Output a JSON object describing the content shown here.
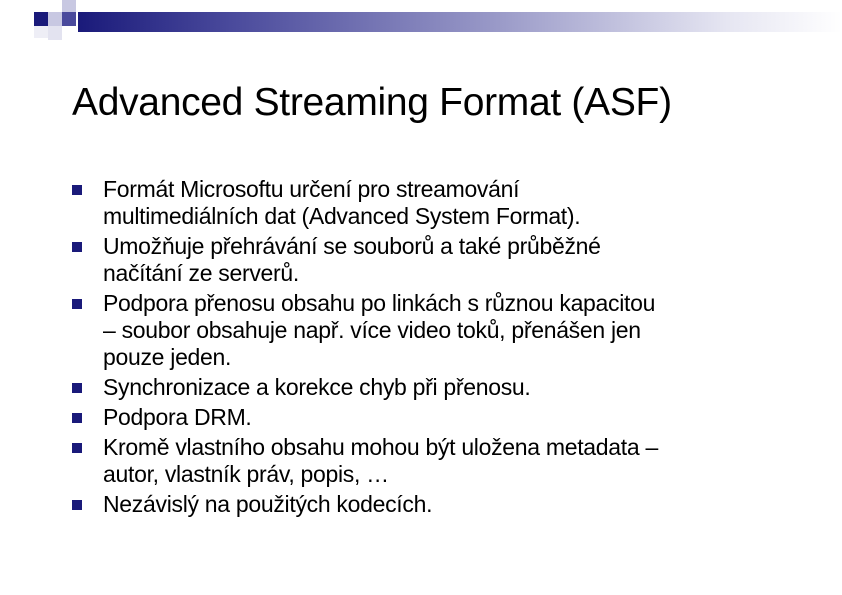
{
  "slide": {
    "title": "Advanced Streaming Format (ASF)",
    "bullets": [
      {
        "lines": [
          "Formát Microsoftu určení pro streamování",
          "multimediálních dat (Advanced System Format)."
        ]
      },
      {
        "lines": [
          "Umožňuje přehrávání se souborů a také průběžné",
          "načítání ze serverů."
        ]
      },
      {
        "lines": [
          "Podpora přenosu obsahu po linkách s různou kapacitou",
          "– soubor obsahuje např. více video toků, přenášen jen",
          "pouze jeden."
        ]
      },
      {
        "lines": [
          "Synchronizace a korekce chyb při přenosu."
        ]
      },
      {
        "lines": [
          "Podpora DRM."
        ]
      },
      {
        "lines": [
          "Kromě vlastního obsahu mohou být uložena metadata –",
          "autor, vlastník práv, popis, …"
        ]
      },
      {
        "lines": [
          "Nezávislý na použitých kodecích."
        ]
      }
    ]
  },
  "colors": {
    "accent": "#1a1a7a",
    "accent_light": "#9a9ac8",
    "text": "#000000",
    "background": "#ffffff"
  }
}
